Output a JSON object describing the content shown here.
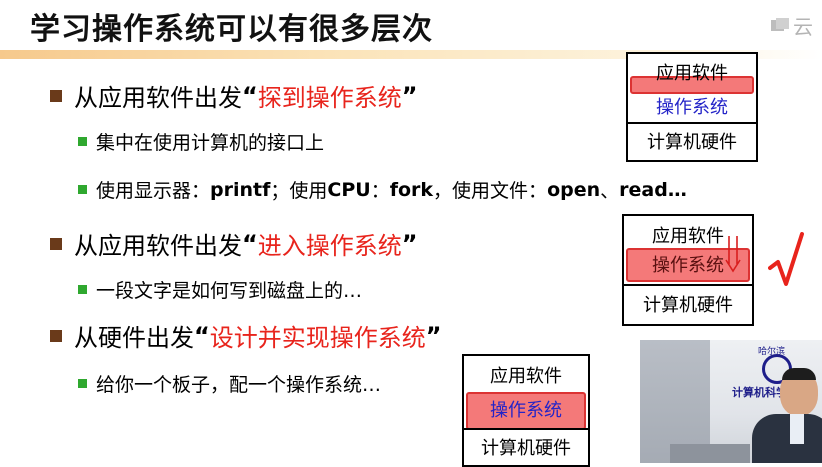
{
  "slide": {
    "title": "学习操作系统可以有很多层次",
    "logo_text": "云",
    "bullets": [
      {
        "prefix": "从应用软件出发",
        "open_quote": "“",
        "highlight": "探到操作系统",
        "close_quote": "”"
      },
      {
        "text": "集中在使用计算机的接口上"
      },
      {
        "part1": "使用显示器：",
        "code1": "printf",
        "part2": "；使用",
        "code2": "CPU",
        "part3": "：",
        "code3": "fork",
        "part4": "，使用文件：",
        "code4": "open",
        "part5": "、",
        "code5": "read…"
      },
      {
        "prefix": "从应用软件出发",
        "open_quote": "“",
        "highlight": "进入操作系统",
        "close_quote": "”"
      },
      {
        "text": "一段文字是如何写到磁盘上的…"
      },
      {
        "prefix": "从硬件出发",
        "open_quote": "“",
        "highlight": "设计并实现操作系统",
        "close_quote": "”"
      },
      {
        "text": "给你一个板子，配一个操作系统…"
      }
    ],
    "stacks": [
      {
        "app": "应用软件",
        "os": "操作系统",
        "hw": "计算机硬件"
      },
      {
        "app": "应用软件",
        "os": "操作系统",
        "hw": "计算机硬件"
      },
      {
        "app": "应用软件",
        "os": "操作系统",
        "hw": "计算机硬件"
      }
    ],
    "video": {
      "banner_top": "哈尔滨",
      "banner": "计算机科学"
    }
  },
  "colors": {
    "highlight_text": "#e8241c",
    "os_label": "#2424c8",
    "bullet_l1": "#6a3a1a",
    "bullet_l2": "#2fa82f",
    "title_rule": "#f6c98c"
  },
  "icons": [
    "cloud-icon",
    "check-icon"
  ]
}
